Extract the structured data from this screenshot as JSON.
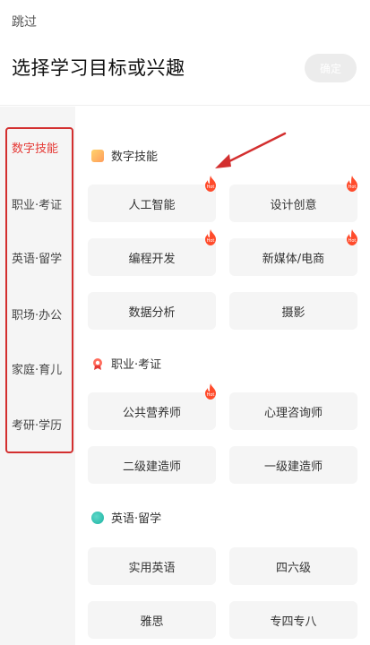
{
  "header": {
    "skip_label": "跳过",
    "title": "选择学习目标或兴趣",
    "confirm_label": "确定"
  },
  "sidebar": {
    "items": [
      {
        "label": "数字技能",
        "active": true
      },
      {
        "label": "职业·考证",
        "active": false
      },
      {
        "label": "英语·留学",
        "active": false
      },
      {
        "label": "职场·办公",
        "active": false
      },
      {
        "label": "家庭·育儿",
        "active": false
      },
      {
        "label": "考研·学历",
        "active": false
      }
    ]
  },
  "sections": [
    {
      "title": "数字技能",
      "icon": "skill-icon",
      "chips": [
        {
          "label": "人工智能",
          "hot": true
        },
        {
          "label": "设计创意",
          "hot": true
        },
        {
          "label": "编程开发",
          "hot": true
        },
        {
          "label": "新媒体/电商",
          "hot": true
        },
        {
          "label": "数据分析",
          "hot": false
        },
        {
          "label": "摄影",
          "hot": false
        }
      ]
    },
    {
      "title": "职业·考证",
      "icon": "certificate-icon",
      "chips": [
        {
          "label": "公共营养师",
          "hot": true
        },
        {
          "label": "心理咨询师",
          "hot": false
        },
        {
          "label": "二级建造师",
          "hot": false
        },
        {
          "label": "一级建造师",
          "hot": false
        }
      ]
    },
    {
      "title": "英语·留学",
      "icon": "language-icon",
      "chips": [
        {
          "label": "实用英语",
          "hot": false
        },
        {
          "label": "四六级",
          "hot": false
        },
        {
          "label": "雅思",
          "hot": false
        },
        {
          "label": "专四专八",
          "hot": false
        }
      ]
    }
  ],
  "colors": {
    "accent": "#e53935",
    "chip_bg": "#f5f5f5",
    "sidebar_bg": "#f5f5f5",
    "annotation": "#d32f2f"
  }
}
